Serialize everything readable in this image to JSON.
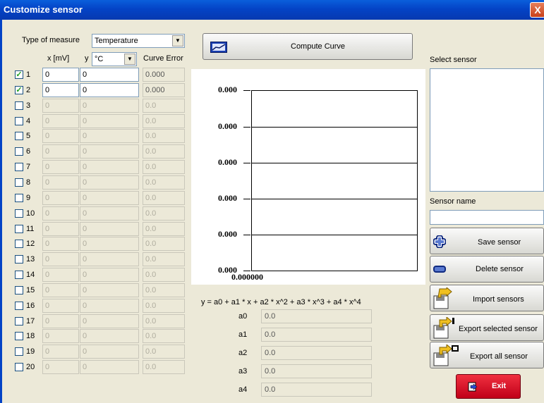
{
  "window": {
    "title": "Customize sensor",
    "close_label": "X"
  },
  "measure": {
    "label": "Type of measure",
    "value": "Temperature"
  },
  "table": {
    "x_header": "x [mV]",
    "y_label": "y",
    "y_unit": "°C",
    "err_header": "Curve Error",
    "rows": [
      {
        "num": "1",
        "checked": true,
        "x": "0",
        "y": "0",
        "err": "0.000"
      },
      {
        "num": "2",
        "checked": true,
        "x": "0",
        "y": "0",
        "err": "0.000"
      },
      {
        "num": "3",
        "checked": false,
        "x": "0",
        "y": "0",
        "err": "0.0"
      },
      {
        "num": "4",
        "checked": false,
        "x": "0",
        "y": "0",
        "err": "0.0"
      },
      {
        "num": "5",
        "checked": false,
        "x": "0",
        "y": "0",
        "err": "0.0"
      },
      {
        "num": "6",
        "checked": false,
        "x": "0",
        "y": "0",
        "err": "0.0"
      },
      {
        "num": "7",
        "checked": false,
        "x": "0",
        "y": "0",
        "err": "0.0"
      },
      {
        "num": "8",
        "checked": false,
        "x": "0",
        "y": "0",
        "err": "0.0"
      },
      {
        "num": "9",
        "checked": false,
        "x": "0",
        "y": "0",
        "err": "0.0"
      },
      {
        "num": "10",
        "checked": false,
        "x": "0",
        "y": "0",
        "err": "0.0"
      },
      {
        "num": "11",
        "checked": false,
        "x": "0",
        "y": "0",
        "err": "0.0"
      },
      {
        "num": "12",
        "checked": false,
        "x": "0",
        "y": "0",
        "err": "0.0"
      },
      {
        "num": "13",
        "checked": false,
        "x": "0",
        "y": "0",
        "err": "0.0"
      },
      {
        "num": "14",
        "checked": false,
        "x": "0",
        "y": "0",
        "err": "0.0"
      },
      {
        "num": "15",
        "checked": false,
        "x": "0",
        "y": "0",
        "err": "0.0"
      },
      {
        "num": "16",
        "checked": false,
        "x": "0",
        "y": "0",
        "err": "0.0"
      },
      {
        "num": "17",
        "checked": false,
        "x": "0",
        "y": "0",
        "err": "0.0"
      },
      {
        "num": "18",
        "checked": false,
        "x": "0",
        "y": "0",
        "err": "0.0"
      },
      {
        "num": "19",
        "checked": false,
        "x": "0",
        "y": "0",
        "err": "0.0"
      },
      {
        "num": "20",
        "checked": false,
        "x": "0",
        "y": "0",
        "err": "0.0"
      }
    ]
  },
  "compute": {
    "label": "Compute Curve",
    "icon": "chart-icon"
  },
  "graph": {
    "y_ticks": [
      "0.000",
      "0.000",
      "0.000",
      "0.000",
      "0.000",
      "0.000"
    ],
    "x_tick": "0.00",
    "x_tick_overlap": "0000"
  },
  "equation": {
    "text": "y = a0 + a1 * x + a2 * x^2 + a3 * x^3 + a4 * x^4"
  },
  "coefficients": [
    {
      "name": "a0",
      "value": "0.0"
    },
    {
      "name": "a1",
      "value": "0.0"
    },
    {
      "name": "a2",
      "value": "0.0"
    },
    {
      "name": "a3",
      "value": "0.0"
    },
    {
      "name": "a4",
      "value": "0.0"
    }
  ],
  "sensors": {
    "select_label": "Select sensor",
    "name_label": "Sensor name",
    "name_value": ""
  },
  "actions": {
    "save": "Save sensor",
    "delete": "Delete sensor",
    "import": "Import sensors",
    "export_selected": "Export selected sensor",
    "export_all": "Export all sensor",
    "exit": "Exit"
  },
  "colors": {
    "title_bar": "#0443c6",
    "exit_button": "#d80f1e",
    "window_bg": "#ece9d8"
  }
}
